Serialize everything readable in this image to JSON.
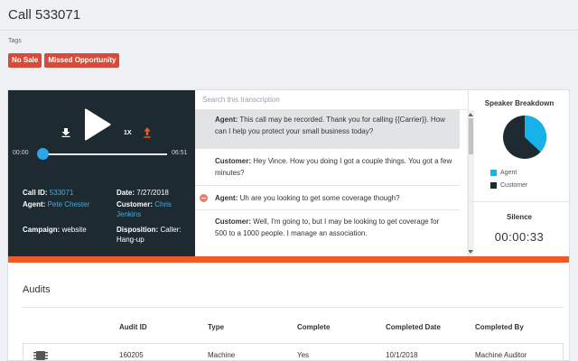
{
  "page": {
    "title": "Call 533071"
  },
  "tags": {
    "label": "Tags",
    "items": [
      "No Sale",
      "Missed Opportunity"
    ]
  },
  "player": {
    "speed": "1X",
    "time_start": "00:00",
    "time_end": "06:51",
    "progress": 0.0,
    "call_id_label": "Call ID:",
    "call_id": "533071",
    "date_label": "Date:",
    "date": "7/27/2018",
    "agent_label": "Agent:",
    "agent": "Pete Chester",
    "customer_label": "Customer:",
    "customer": "Chris Jenkins",
    "campaign_label": "Campaign:",
    "campaign": "website",
    "disposition_label": "Disposition:",
    "disposition": "Caller: Hang-up"
  },
  "transcript": {
    "search_placeholder": "Search this transcription",
    "messages": [
      {
        "speaker": "Agent:",
        "text": "This call may be recorded. Thank you for calling {{Carrier}}. How can I help you protect your small business today?",
        "active": true
      },
      {
        "speaker": "Customer:",
        "text": "Hey Vince. How you doing I got a couple things. You got a few minutes?",
        "active": false
      },
      {
        "speaker": "Agent:",
        "text": "Uh are you looking to get some coverage though?",
        "active": false
      },
      {
        "speaker": "Customer:",
        "text": "Well, I'm going to, but I may be looking to get coverage for 500 to a 1000 people. I manage an association.",
        "active": false
      }
    ]
  },
  "speaker_breakdown": {
    "title": "Speaker Breakdown",
    "agent_share": 0.37,
    "legend": [
      {
        "name": "Agent",
        "color": "#17b3e8"
      },
      {
        "name": "Customer",
        "color": "#1d2a32"
      }
    ],
    "silence_title": "Silence",
    "silence_time": "00:00:33"
  },
  "audits": {
    "title": "Audits",
    "columns": [
      "Audit ID",
      "Type",
      "Complete",
      "Completed Date",
      "Completed By"
    ],
    "rows": [
      {
        "audit_id": "160205",
        "type": "Machine",
        "complete": "Yes",
        "completed_date": "10/1/2018",
        "completed_by": "Machine Auditor"
      }
    ]
  },
  "colors": {
    "accent": "#f05a24",
    "tag": "#d84b3a",
    "player_bg": "#1d2a32",
    "link": "#4ea8d8",
    "knob": "#2aa8e6"
  }
}
